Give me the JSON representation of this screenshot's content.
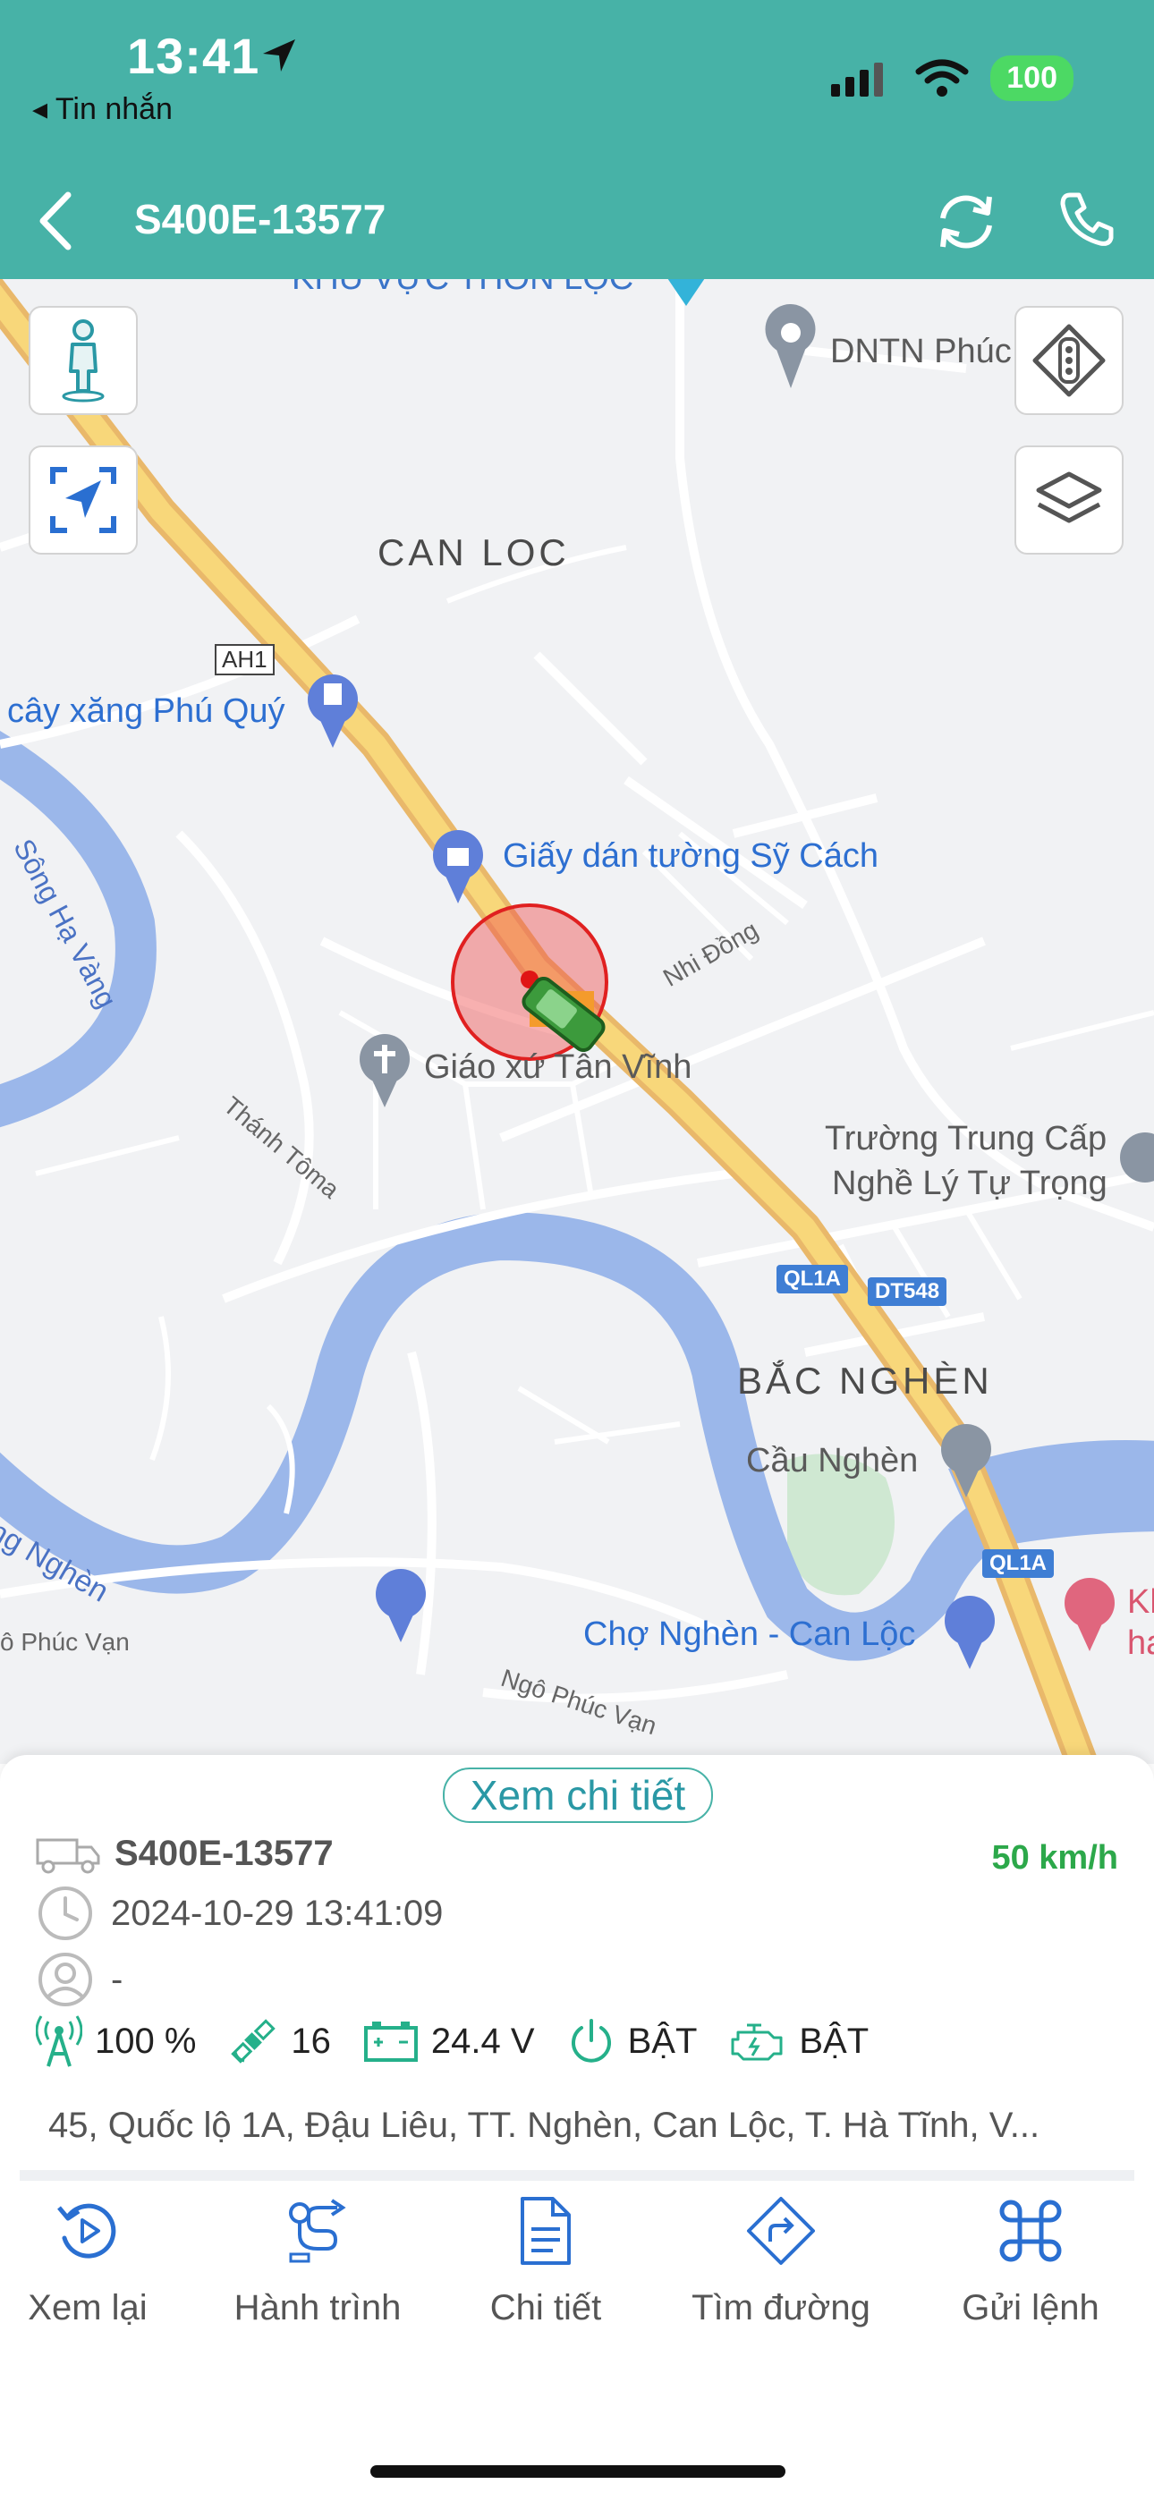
{
  "status_bar": {
    "time": "13:41",
    "back_app": "◂ Tin nhắn",
    "battery": "100"
  },
  "nav": {
    "title": "S400E-13577"
  },
  "map": {
    "area_labels": [
      "CAN LOC",
      "BẮC NGHÈN"
    ],
    "pois": {
      "top_cut": "KHU VỰC THÔN LỘC",
      "dntn": "DNTN Phúc",
      "gas": "cây xăng Phú Quý",
      "sticker": "Giấy dán tường Sỹ Cách",
      "church": "Giáo xứ Tân Vĩnh",
      "school_1": "Trường Trung Cấp",
      "school_2": "Nghề Lý Tự Trọng",
      "bridge": "Cầu Nghèn",
      "market": "Chợ Nghèn - Can Lộc",
      "kh": "Kh",
      "ha": "ha"
    },
    "streets": {
      "nhi_dong": "Nhi Đồng",
      "thanh_toma": "Thánh Tôma",
      "ngo_phuc_van": "Ngô Phúc Vạn",
      "phuc_van": "ô Phúc Vạn",
      "song_ha_vang": "Sông Hạ Vàng",
      "song_nghen": "ng Nghèn"
    },
    "shields": {
      "ah1": "AH1",
      "ql1a_1": "QL1A",
      "dt548": "DT548",
      "ql1a_2": "QL1A"
    }
  },
  "panel": {
    "detail_button": "Xem chi tiết",
    "plate": "S400E-13577",
    "speed": "50 km/h",
    "timestamp": "2024-10-29 13:41:09",
    "driver": "-",
    "stats": {
      "signal": "100 %",
      "satellites": "16",
      "voltage": "24.4 V",
      "power": "BẬT",
      "engine": "BẬT"
    },
    "address": "45, Quốc lộ 1A,  Đậu Liêu, TT. Nghèn, Can Lộc, T. Hà Tĩnh, V...",
    "actions": [
      "Xem lại",
      "Hành trình",
      "Chi tiết",
      "Tìm đường",
      "Gửi lệnh"
    ]
  },
  "colors": {
    "header": "#47b2a7",
    "accent": "#2a98a5",
    "speed": "#2ca84a",
    "stat_icon": "#25b08a"
  }
}
